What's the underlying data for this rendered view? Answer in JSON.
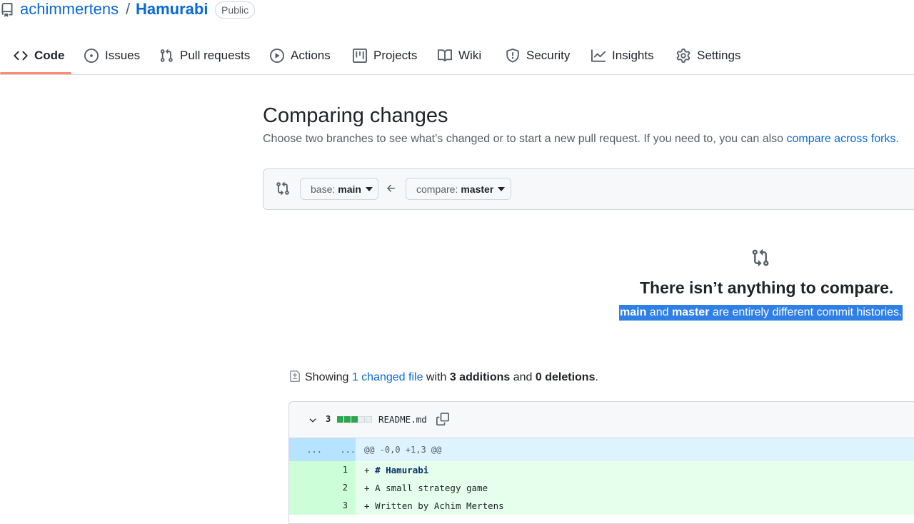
{
  "repo": {
    "owner": "achimmertens",
    "separator": "/",
    "name": "Hamurabi",
    "visibility": "Public"
  },
  "tabs": [
    {
      "label": "Code",
      "icon": "code-icon",
      "active": true
    },
    {
      "label": "Issues",
      "icon": "issue-opened-icon"
    },
    {
      "label": "Pull requests",
      "icon": "git-pull-request-icon"
    },
    {
      "label": "Actions",
      "icon": "play-icon"
    },
    {
      "label": "Projects",
      "icon": "table-icon"
    },
    {
      "label": "Wiki",
      "icon": "book-icon"
    },
    {
      "label": "Security",
      "icon": "shield-icon"
    },
    {
      "label": "Insights",
      "icon": "graph-icon"
    },
    {
      "label": "Settings",
      "icon": "gear-icon"
    }
  ],
  "compare": {
    "title": "Comparing changes",
    "subtitle": "Choose two branches to see what’s changed or to start a new pull request. If you need to, you can also ",
    "forks_link": "compare across forks",
    "subtitle_end": ".",
    "base_label": "base:",
    "base_branch": "main",
    "compare_label": "compare:",
    "compare_branch": "master"
  },
  "blankslate": {
    "title": "There isn’t anything to compare.",
    "branch_a": "main",
    "and": "and",
    "branch_b": "master",
    "desc_rest": "are entirely different commit histories."
  },
  "diffstat": {
    "showing": "Showing",
    "changed_link": "1 changed file",
    "with": "with",
    "additions": "3 additions",
    "and": "and",
    "deletions": "0 deletions",
    "end": "."
  },
  "file": {
    "count": "3",
    "blocks": {
      "additions": 3,
      "neutral": 2
    },
    "name": "README.md",
    "hunk_left": "...",
    "hunk_right": "...",
    "hunk_header": "@@ -0,0 +1,3 @@",
    "lines": [
      {
        "num": "1",
        "prefix": "+ ",
        "text": "# Hamurabi",
        "bold": true
      },
      {
        "num": "2",
        "prefix": "+ ",
        "text": "A small strategy game",
        "bold": false
      },
      {
        "num": "3",
        "prefix": "+ ",
        "text": "Written by Achim Mertens",
        "bold": false
      }
    ]
  },
  "colors": {
    "link": "#0969da",
    "tab_underline": "#fd8c73",
    "selection": "#2f7fe6",
    "addition_bg": "#e6ffec",
    "addition_num_bg": "#ccffd8",
    "hunk_bg": "#ddf4ff"
  }
}
